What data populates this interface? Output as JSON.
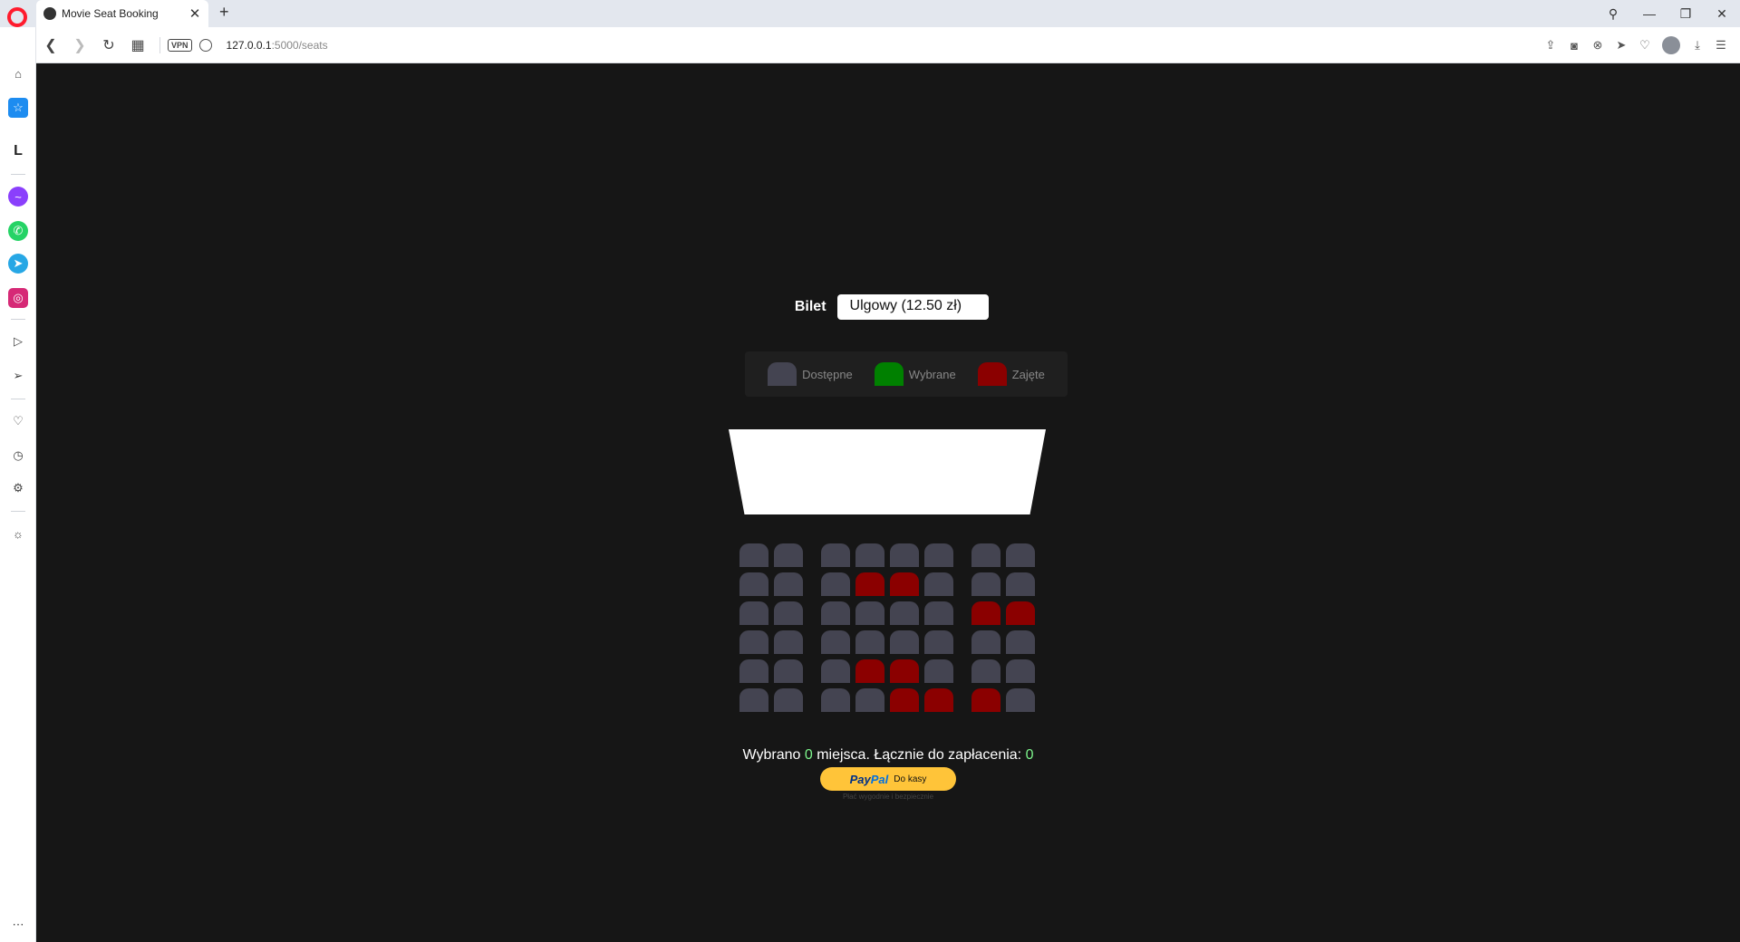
{
  "browser": {
    "tab_title": "Movie Seat Booking",
    "tab_close": "✕",
    "new_tab": "+",
    "url_host": "127.0.0.1",
    "url_path": ":5000/seats",
    "vpn_label": "VPN",
    "window_controls": [
      "⚲",
      "—",
      "❐",
      "✕"
    ]
  },
  "sidebar": {
    "icons": [
      "home-icon",
      "star-icon",
      "l-icon",
      "messenger-icon",
      "whatsapp-icon",
      "telegram-icon",
      "instagram-icon",
      "player-icon",
      "send-icon",
      "heart-icon",
      "history-icon",
      "settings-icon",
      "lightbulb-icon",
      "more-icon"
    ]
  },
  "ticket": {
    "label": "Bilet",
    "selected": "Ulgowy (12.50 zł)"
  },
  "legend": {
    "available": "Dostępne",
    "selected": "Wybrane",
    "occupied": "Zajęte"
  },
  "colors": {
    "available": "#444451",
    "selected": "#008000",
    "occupied": "#8b0000",
    "highlight": "#7df58c",
    "paypal": "#ffc439"
  },
  "seat_map": {
    "rows": [
      [
        0,
        0,
        0,
        0,
        0,
        0,
        0,
        0
      ],
      [
        0,
        0,
        0,
        1,
        1,
        0,
        0,
        0
      ],
      [
        0,
        0,
        0,
        0,
        0,
        0,
        1,
        1
      ],
      [
        0,
        0,
        0,
        0,
        0,
        0,
        0,
        0
      ],
      [
        0,
        0,
        0,
        1,
        1,
        0,
        0,
        0
      ],
      [
        0,
        0,
        0,
        0,
        1,
        1,
        1,
        0
      ]
    ],
    "note_values": "1 = occupied, 0 = available"
  },
  "summary": {
    "prefix": "Wybrano ",
    "count": "0",
    "middle": " miejsca. Łącznie do zapłacenia: ",
    "total": "0"
  },
  "paypal": {
    "brand1": "Pay",
    "brand2": "Pal",
    "cta": "Do kasy",
    "powered": "Płać wygodnie i bezpiecznie"
  }
}
